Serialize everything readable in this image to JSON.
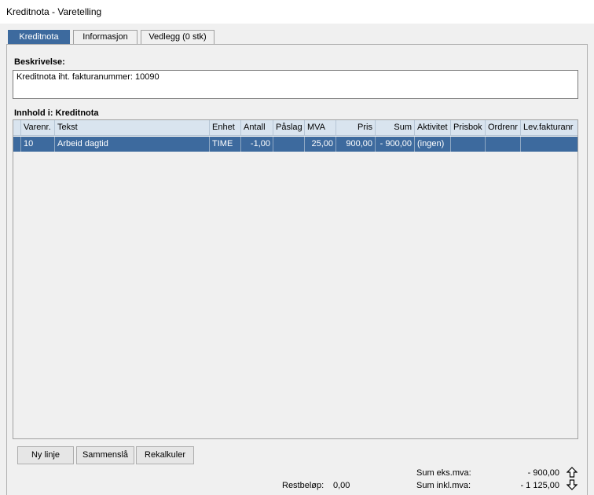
{
  "window": {
    "title": "Kreditnota - Varetelling"
  },
  "tabs": [
    {
      "label": "Kreditnota"
    },
    {
      "label": "Informasjon"
    },
    {
      "label": "Vedlegg (0 stk)"
    }
  ],
  "description": {
    "label": "Beskrivelse:",
    "value": "Kreditnota iht. fakturanummer: 10090"
  },
  "content": {
    "label": "Innhold i: Kreditnota",
    "columns": [
      "Varenr.",
      "Tekst",
      "Enhet",
      "Antall",
      "Påslag",
      "MVA",
      "Pris",
      "Sum",
      "Aktivitet",
      "Prisbok",
      "Ordrenr",
      "Lev.fakturanr"
    ],
    "rows": [
      {
        "varenr": "10",
        "tekst": "Arbeid dagtid",
        "enhet": "TIME",
        "antall": "-1,00",
        "paslag": "",
        "mva": "25,00",
        "pris": "900,00",
        "sum": "- 900,00",
        "aktivitet": "(ingen)",
        "prisbok": "",
        "ordrenr": "",
        "levfakturanr": ""
      }
    ]
  },
  "buttons": {
    "new_line": "Ny linje",
    "merge": "Sammenslå",
    "recalc": "Rekalkuler"
  },
  "totals": {
    "rest_label": "Restbeløp:",
    "rest_value": "0,00",
    "sum_ex_label": "Sum eks.mva:",
    "sum_ex_value": "- 900,00",
    "sum_inc_label": "Sum inkl.mva:",
    "sum_inc_value": "- 1 125,00"
  },
  "colors": {
    "selection": "#3d6a9e",
    "header": "#d9e4ef"
  },
  "icons": {
    "up": "arrow-up-icon",
    "down": "arrow-down-icon"
  }
}
